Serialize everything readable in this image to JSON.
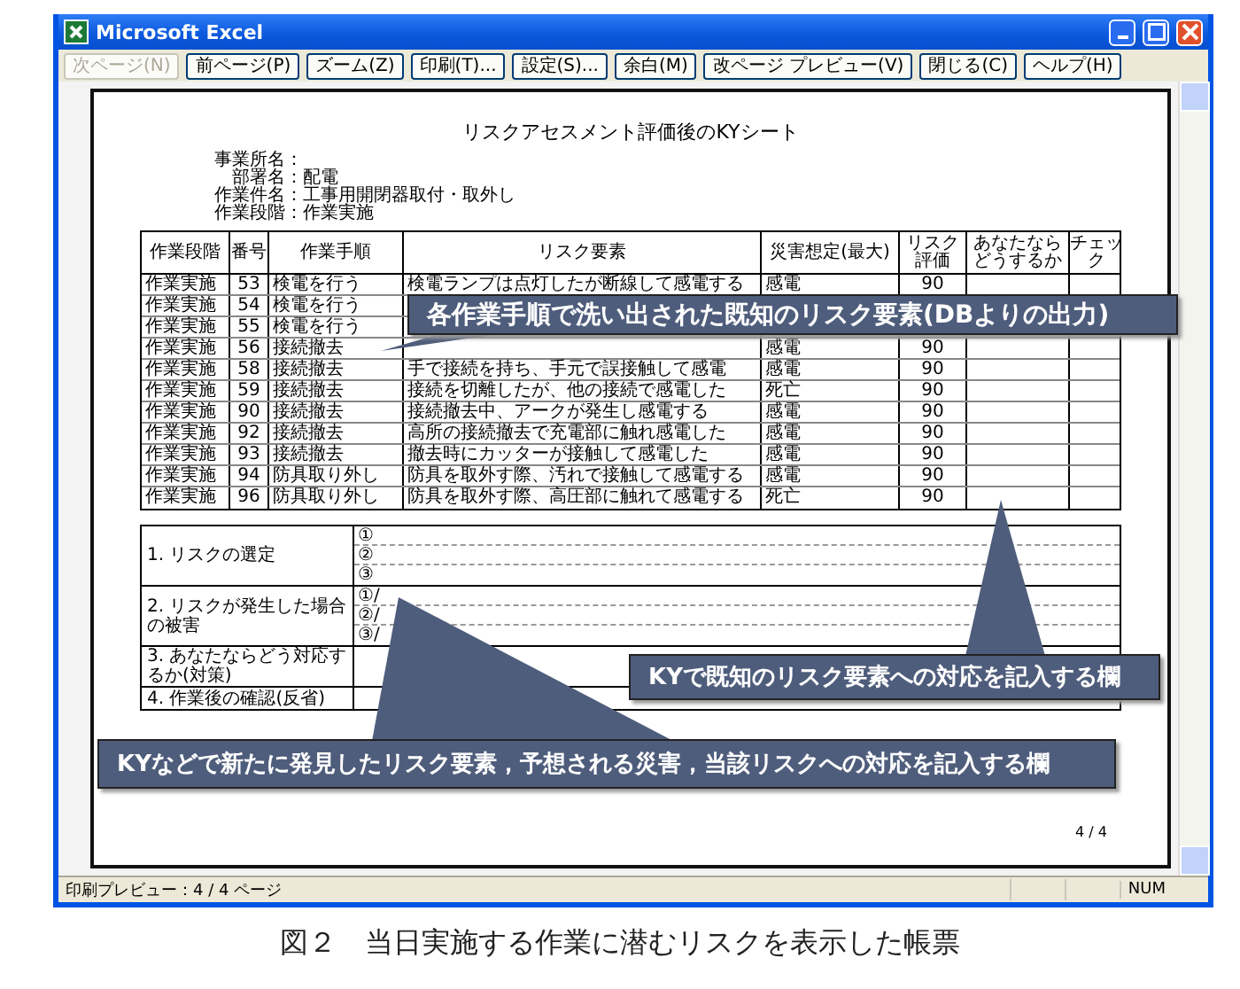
{
  "window": {
    "title": "Microsoft Excel"
  },
  "toolbar": [
    {
      "label": "次ページ(N)",
      "disabled": true
    },
    {
      "label": "前ページ(P)",
      "disabled": false
    },
    {
      "label": "ズーム(Z)",
      "disabled": false
    },
    {
      "label": "印刷(T)...",
      "disabled": false
    },
    {
      "label": "設定(S)...",
      "disabled": false
    },
    {
      "label": "余白(M)",
      "disabled": false
    },
    {
      "label": "改ページ プレビュー(V)",
      "disabled": false
    },
    {
      "label": "閉じる(C)",
      "disabled": false
    },
    {
      "label": "ヘルプ(H)",
      "disabled": false
    }
  ],
  "sheet": {
    "title": "リスクアセスメント評価後のKYシート",
    "info": [
      {
        "label": "事業所名："
      },
      {
        "label": "部署名：",
        "value": "配電"
      },
      {
        "label": "作業件名：",
        "value": "工事用開閉器取付・取外し"
      },
      {
        "label": "作業段階：",
        "value": "作業実施"
      }
    ],
    "columns": [
      "作業段階",
      "番号",
      "作業手順",
      "リスク要素",
      "災害想定(最大)",
      "リスク評価",
      "あなたならどうするか",
      "チェック"
    ],
    "rows": [
      {
        "stage": "作業実施",
        "number": "53",
        "step": "検電を行う",
        "risk": "検電ランプは点灯したが断線して感電する",
        "disaster": "感電",
        "rating": "90"
      },
      {
        "stage": "作業実施",
        "number": "54",
        "step": "検電を行う"
      },
      {
        "stage": "作業実施",
        "number": "55",
        "step": "検電を行う"
      },
      {
        "stage": "作業実施",
        "number": "56",
        "step": "接続撤去",
        "disaster": "感電",
        "rating": "90"
      },
      {
        "stage": "作業実施",
        "number": "58",
        "step": "接続撤去",
        "risk": "手で接続を持ち、手元で誤接触して感電",
        "disaster": "感電",
        "rating": "90"
      },
      {
        "stage": "作業実施",
        "number": "59",
        "step": "接続撤去",
        "risk": "接続を切離したが、他の接続で感電した",
        "disaster": "死亡",
        "rating": "90"
      },
      {
        "stage": "作業実施",
        "number": "90",
        "step": "接続撤去",
        "risk": "接続撤去中、アークが発生し感電する",
        "disaster": "感電",
        "rating": "90"
      },
      {
        "stage": "作業実施",
        "number": "92",
        "step": "接続撤去",
        "risk": "高所の接続撤去で充電部に触れ感電した",
        "disaster": "感電",
        "rating": "90"
      },
      {
        "stage": "作業実施",
        "number": "93",
        "step": "接続撤去",
        "risk": "撤去時にカッターが接触して感電した",
        "disaster": "感電",
        "rating": "90"
      },
      {
        "stage": "作業実施",
        "number": "94",
        "step": "防具取り外し",
        "risk": "防具を取外す際、汚れで接触して感電する",
        "disaster": "感電",
        "rating": "90"
      },
      {
        "stage": "作業実施",
        "number": "96",
        "step": "防具取り外し",
        "risk": "防具を取外す際、高圧部に触れて感電する",
        "disaster": "死亡",
        "rating": "90"
      }
    ],
    "form": [
      {
        "label": "1. リスクの選定",
        "lines": [
          "①",
          "②",
          "③"
        ]
      },
      {
        "label": "2. リスクが発生した場合の被害",
        "lines": [
          "①/",
          "②/",
          "③/"
        ]
      },
      {
        "label": "3. あなたならどう対応するか(対策)"
      },
      {
        "label": "4. 作業後の確認(反省)"
      }
    ],
    "page_number": "4 / 4",
    "callouts": [
      {
        "kind": "top",
        "text": "各作業手順で洗い出された既知のリスク要素(DBよりの出力)"
      },
      {
        "kind": "right",
        "text": "KYで既知のリスク要素への対応を記入する欄"
      },
      {
        "kind": "bottom",
        "text": "KYなどで新たに発見したリスク要素，予想される災害，当該リスクへの対応を記入する欄"
      }
    ]
  },
  "status_bar": {
    "text": "印刷プレビュー：4 / 4 ページ",
    "indicator": "NUM"
  },
  "caption": "図２　当日実施する作業に潜むリスクを表示した帳票"
}
